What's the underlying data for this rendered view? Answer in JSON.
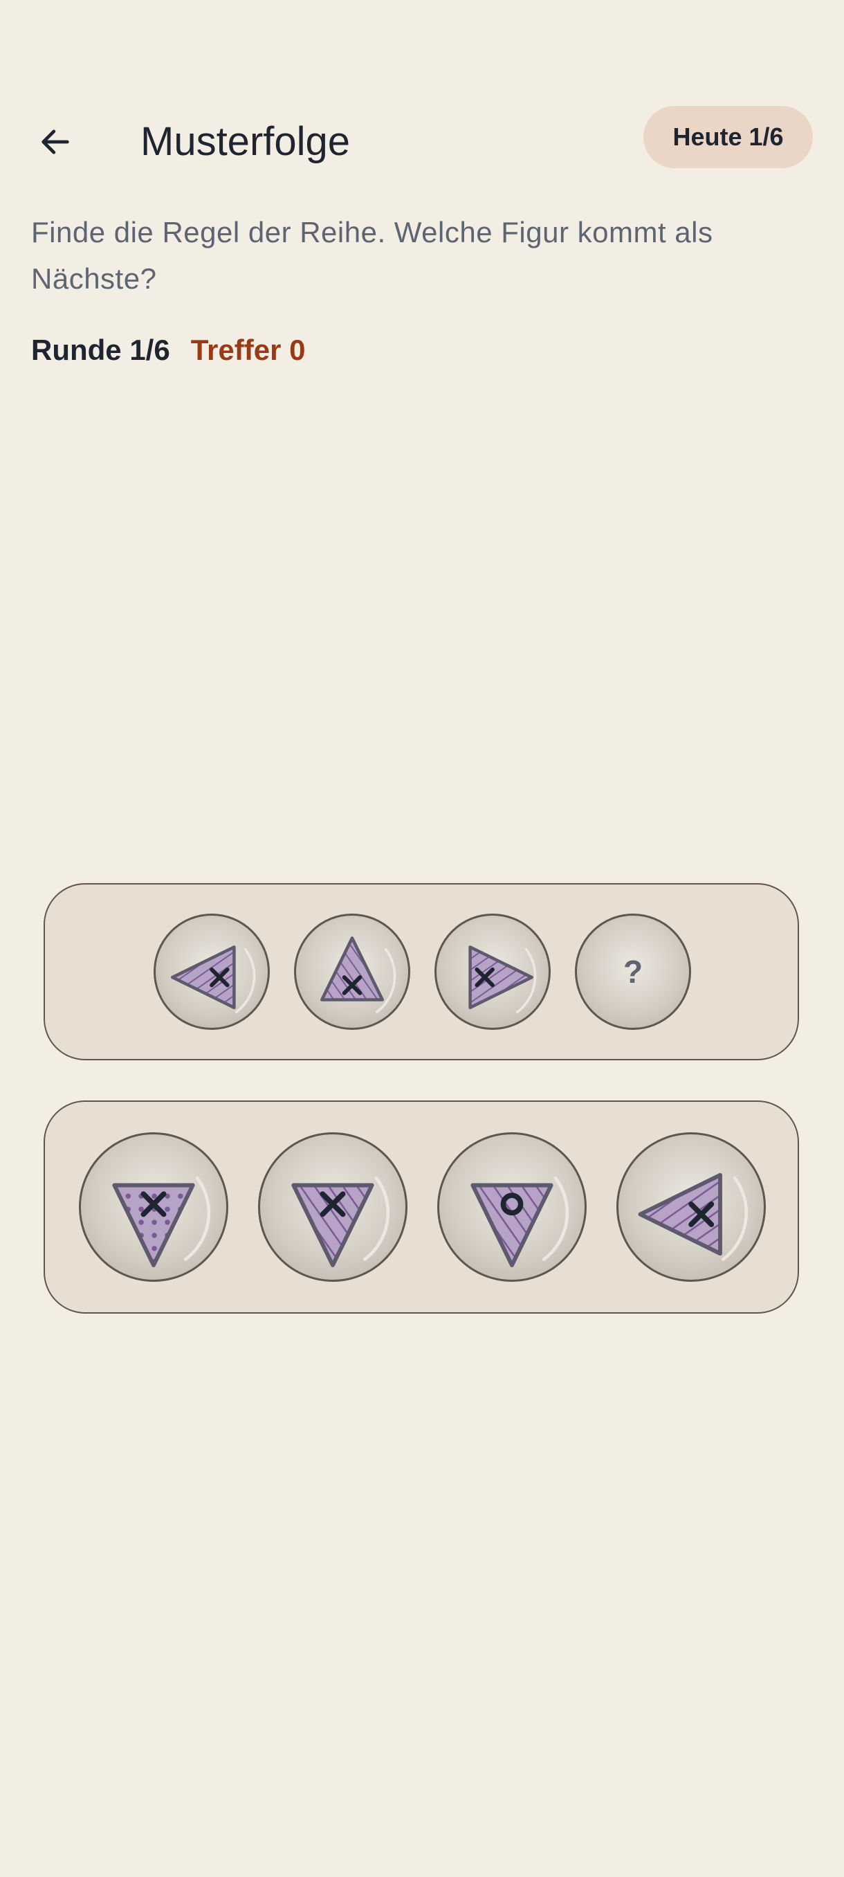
{
  "header": {
    "back_icon": "arrow-left-icon",
    "title": "Musterfolge",
    "badge": "Heute 1/6"
  },
  "instruction": "Finde die Regel der Reihe. Welche Figur kommt als Nächste?",
  "stats": {
    "round": "Runde 1/6",
    "hits": "Treffer 0"
  },
  "colors": {
    "background": "#f3eee4",
    "panel": "#e8dfd2",
    "shape_fill": "#b7a3c6",
    "shape_stroke": "#5e5a6e",
    "pattern": "#7a5a95",
    "hits": "#9a3a14"
  },
  "sequence": [
    {
      "shape": "triangle",
      "direction": "left",
      "fill": "stripes",
      "mark": "x"
    },
    {
      "shape": "triangle",
      "direction": "up",
      "fill": "stripes",
      "mark": "x"
    },
    {
      "shape": "triangle",
      "direction": "right",
      "fill": "stripes",
      "mark": "x"
    },
    {
      "placeholder": "?"
    }
  ],
  "options": [
    {
      "shape": "triangle",
      "direction": "down",
      "fill": "dots",
      "mark": "x"
    },
    {
      "shape": "triangle",
      "direction": "down",
      "fill": "stripes",
      "mark": "x"
    },
    {
      "shape": "triangle",
      "direction": "down",
      "fill": "stripes",
      "mark": "o"
    },
    {
      "shape": "triangle",
      "direction": "left",
      "fill": "stripes",
      "mark": "x"
    }
  ]
}
